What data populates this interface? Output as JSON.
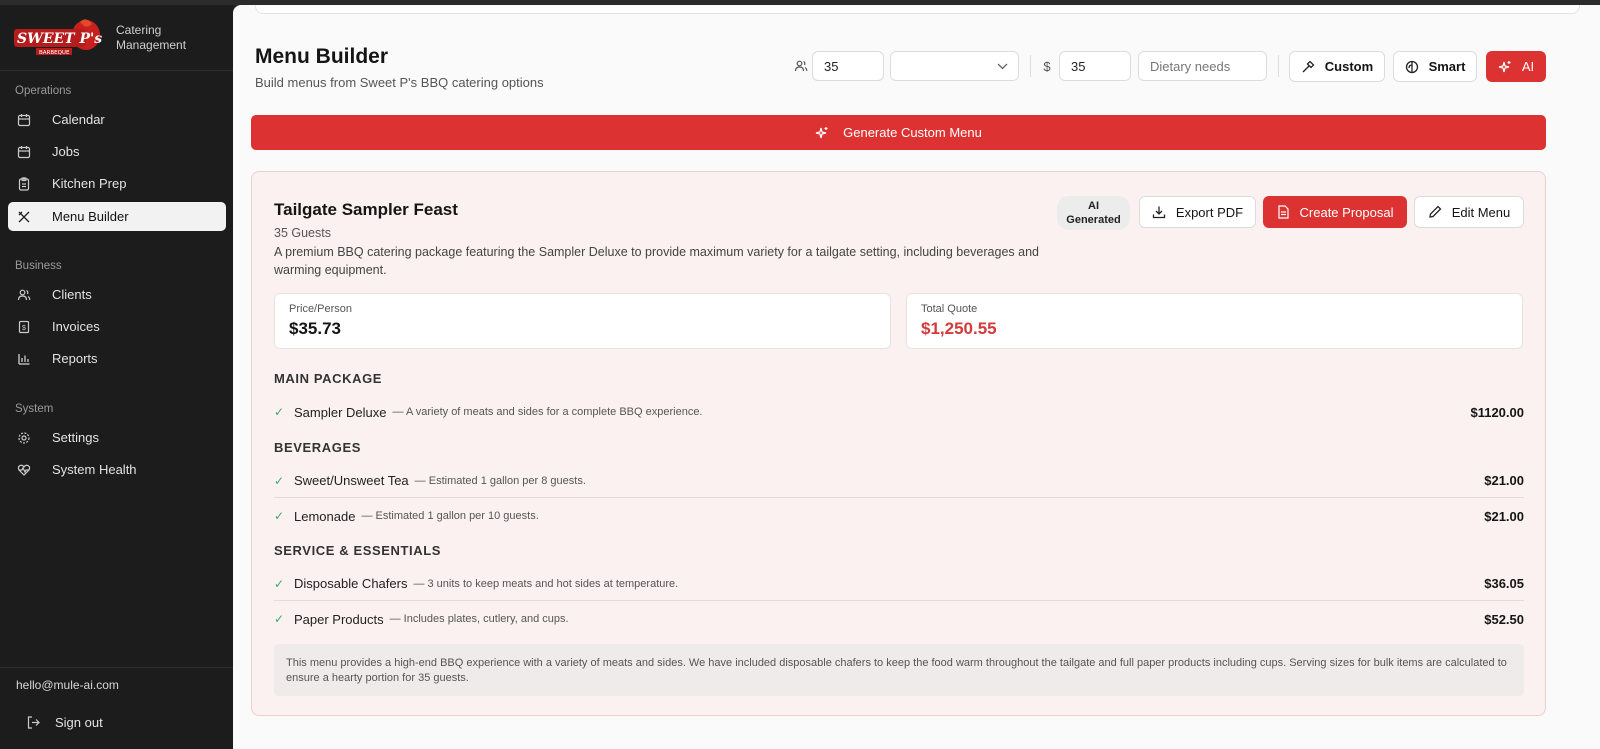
{
  "brand": {
    "logo_text": "SWEET P's",
    "logo_subtext": "BARBEQUE",
    "app_line1": "Catering",
    "app_line2": "Management"
  },
  "sidebar": {
    "sections": [
      "Operations",
      "Business",
      "System"
    ],
    "items": [
      {
        "label": "Calendar",
        "icon": "calendar-icon"
      },
      {
        "label": "Jobs",
        "icon": "calendar-icon"
      },
      {
        "label": "Kitchen Prep",
        "icon": "clipboard-icon"
      },
      {
        "label": "Menu Builder",
        "icon": "utensils-icon",
        "active": true
      },
      {
        "label": "Clients",
        "icon": "users-icon"
      },
      {
        "label": "Invoices",
        "icon": "receipt-icon"
      },
      {
        "label": "Reports",
        "icon": "bar-chart-icon"
      },
      {
        "label": "Settings",
        "icon": "gear-icon"
      },
      {
        "label": "System Health",
        "icon": "heart-pulse-icon"
      }
    ],
    "email": "hello@mule-ai.com",
    "signout": "Sign out"
  },
  "header": {
    "title": "Menu Builder",
    "subtitle": "Build menus from Sweet P's BBQ catering options"
  },
  "controls": {
    "guests_value": "35",
    "event_type_value": "",
    "budget_symbol": "$",
    "budget_value": "35",
    "dietary_placeholder": "Dietary needs",
    "custom_label": "Custom",
    "smart_label": "Smart",
    "ai_label": "AI"
  },
  "generate_label": "Generate Custom Menu",
  "result": {
    "title": "Tailgate Sampler Feast",
    "guests": "35 Guests",
    "description": "A premium BBQ catering package featuring the Sampler Deluxe to provide maximum variety for a tailgate setting, including beverages and warming equipment.",
    "badge_line1": "AI",
    "badge_line2": "Generated",
    "export_label": "Export PDF",
    "proposal_label": "Create Proposal",
    "edit_label": "Edit Menu",
    "price_person_label": "Price/Person",
    "price_person_value": "$35.73",
    "total_label": "Total Quote",
    "total_value": "$1,250.55",
    "sections": [
      {
        "heading": "MAIN PACKAGE",
        "items": [
          {
            "name": "Sampler Deluxe",
            "note": "— A variety of meats and sides for a complete BBQ experience.",
            "price": "$1120.00"
          }
        ]
      },
      {
        "heading": "BEVERAGES",
        "items": [
          {
            "name": "Sweet/Unsweet Tea",
            "note": "— Estimated 1 gallon per 8 guests.",
            "price": "$21.00"
          },
          {
            "name": "Lemonade",
            "note": "— Estimated 1 gallon per 10 guests.",
            "price": "$21.00"
          }
        ]
      },
      {
        "heading": "SERVICE & ESSENTIALS",
        "items": [
          {
            "name": "Disposable Chafers",
            "note": "— 3 units to keep meats and hot sides at temperature.",
            "price": "$36.05"
          },
          {
            "name": "Paper Products",
            "note": "— Includes plates, cutlery, and cups.",
            "price": "$52.50"
          }
        ]
      }
    ],
    "summary": "This menu provides a high-end BBQ experience with a variety of meats and sides. We have included disposable chafers to keep the food warm throughout the tailgate and full paper products including cups. Serving sizes for bulk items are calculated to ensure a hearty portion for 35 guests."
  },
  "colors": {
    "accent": "#dc3232",
    "sidebar_bg": "#1c1c1c",
    "check": "#3ea86a",
    "total_red": "#d43a3a"
  }
}
